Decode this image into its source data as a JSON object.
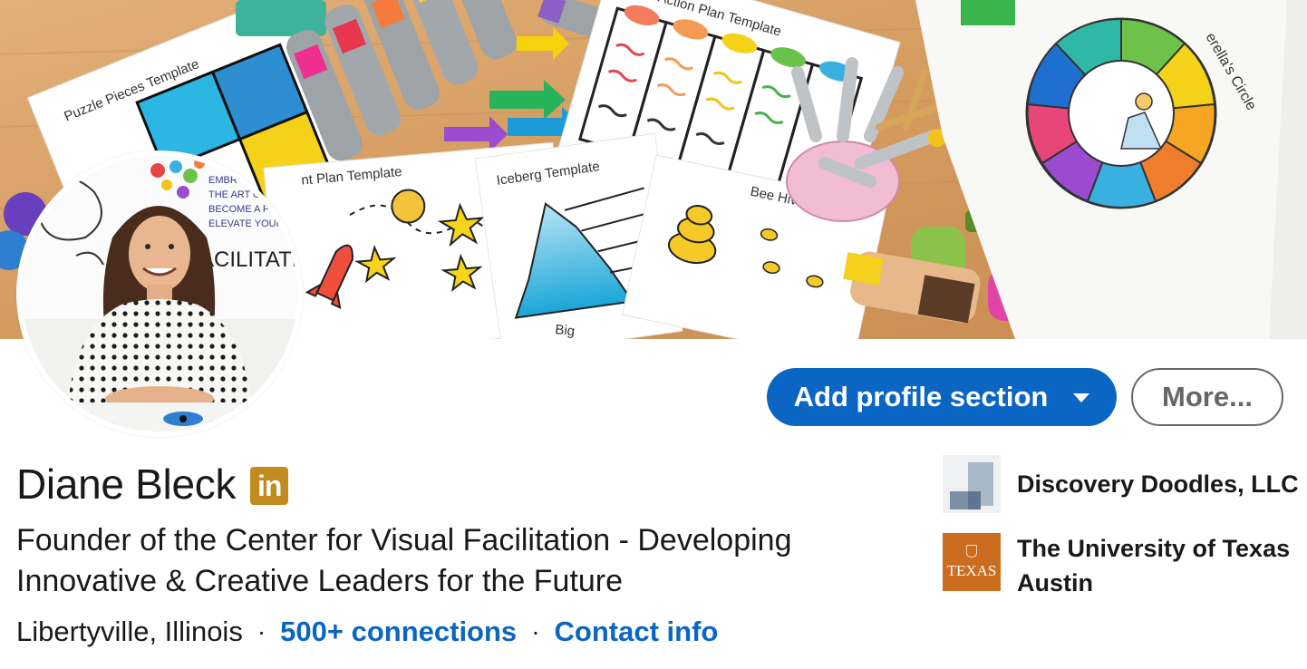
{
  "profile": {
    "name": "Diane Bleck",
    "badge": "in",
    "headline": "Founder of the Center for Visual Facilitation - Developing Innovative & Creative Leaders for the Future",
    "location": "Libertyville, Illinois",
    "separator": "·",
    "connections": "500+ connections",
    "contact": "Contact info"
  },
  "actions": {
    "add_section": "Add profile section",
    "more": "More..."
  },
  "orgs": [
    {
      "name": "Discovery Doodles, LLC",
      "logo": "building-blocks-logo"
    },
    {
      "name": "The University of Texas Austin",
      "logo_text": "TEXAS"
    }
  ],
  "banner": {
    "labels": [
      "Puzzle Pieces Template",
      "Action Plan Template",
      "Iceberg Template",
      "Bee Hive Template",
      "nt Plan Template",
      "erella's Circle",
      "Big"
    ]
  },
  "avatar": {
    "board_lines": [
      "EMBR",
      "THE ART O",
      "BECOME A F",
      "ELEVATE YOUR",
      "ACILITATION"
    ]
  },
  "colors": {
    "primary": "#0a66c2",
    "badge": "#c18b1e",
    "texas": "#cc6c1e"
  }
}
